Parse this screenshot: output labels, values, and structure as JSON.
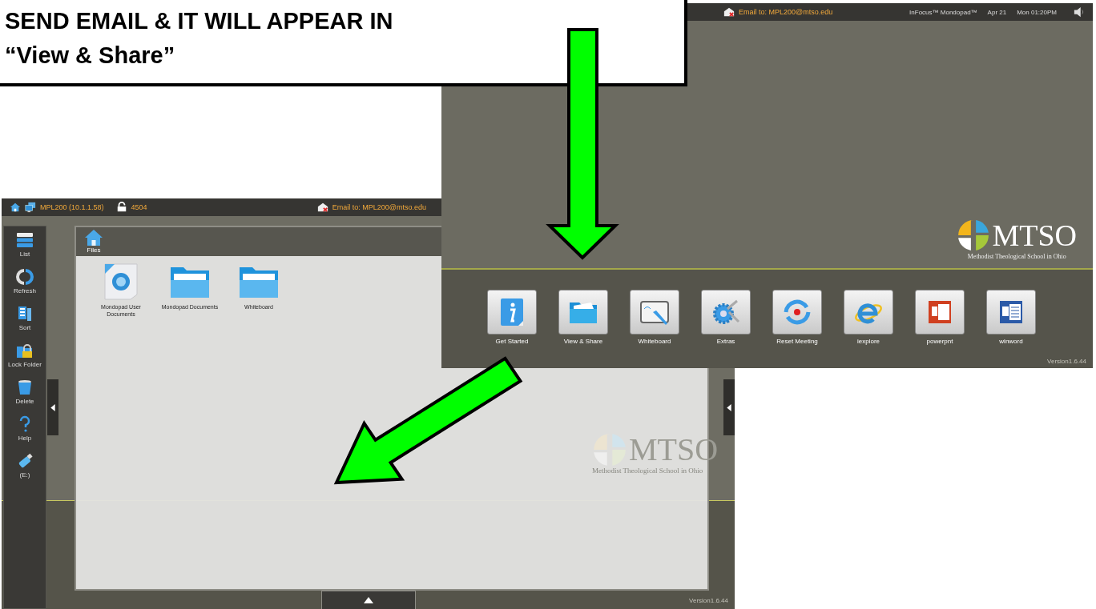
{
  "callout": {
    "lines": [
      "SEND EMAIL & IT WILL APPEAR IN",
      "“View & Share”"
    ]
  },
  "home_screen": {
    "email": "Email to: MPL200@mtso.edu",
    "brand": "InFocus™ Mondopad™",
    "date": "Apr 21",
    "time": "Mon 01:20PM",
    "logo": {
      "wordmark": "MTSO",
      "subtitle": "Methodist Theological School in Ohio"
    },
    "apps": [
      {
        "label": "Get Started",
        "kind": "info"
      },
      {
        "label": "View & Share",
        "kind": "folder"
      },
      {
        "label": "Whiteboard",
        "kind": "whiteboard"
      },
      {
        "label": "Extras",
        "kind": "gear"
      },
      {
        "label": "Reset Meeting",
        "kind": "reset"
      },
      {
        "label": "iexplore",
        "kind": "browser"
      },
      {
        "label": "powerpnt",
        "kind": "slides"
      },
      {
        "label": "winword",
        "kind": "doc"
      }
    ],
    "version": "Version1.6.44"
  },
  "files_screen": {
    "device": "MPL200 (10.1.1.58)",
    "code": "4504",
    "email": "Email to: MPL200@mtso.edu",
    "sidebar": [
      {
        "label": "List",
        "kind": "list"
      },
      {
        "label": "Refresh",
        "kind": "refresh"
      },
      {
        "label": "Sort",
        "kind": "sort"
      },
      {
        "label": "Lock Folder",
        "kind": "lock"
      },
      {
        "label": "Delete",
        "kind": "trash"
      },
      {
        "label": "Help",
        "kind": "help"
      },
      {
        "label": "(E:)",
        "kind": "usb"
      }
    ],
    "location": "Files",
    "files": [
      {
        "name": "Mondopad User Documents",
        "kind": "link"
      },
      {
        "name": "Mondopad Documents",
        "kind": "folder"
      },
      {
        "name": "Whiteboard",
        "kind": "folder"
      }
    ],
    "watermark": {
      "wordmark": "MTSO",
      "subtitle": "Methodist Theological School in Ohio"
    },
    "version": "Version1.6.44"
  }
}
